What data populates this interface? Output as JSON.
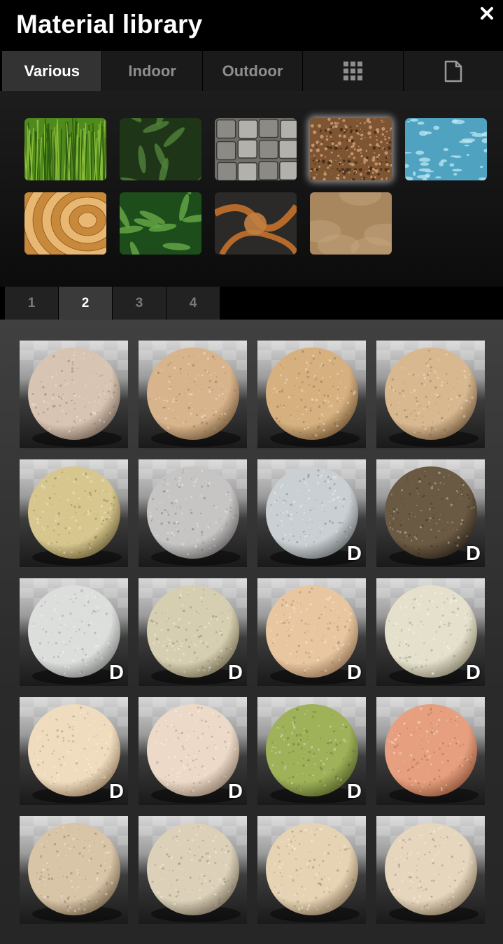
{
  "window": {
    "title": "Material library"
  },
  "tabs": [
    {
      "label": "Various",
      "active": true
    },
    {
      "label": "Indoor",
      "active": false
    },
    {
      "label": "Outdoor",
      "active": false
    },
    {
      "icon": "grid-icon",
      "active": false
    },
    {
      "icon": "document-icon",
      "active": false
    }
  ],
  "categories": [
    {
      "name": "grass",
      "colors": [
        "#4f8a1c",
        "#8cbd3a"
      ],
      "pattern": "grass"
    },
    {
      "name": "leaves",
      "colors": [
        "#1e3517",
        "#4e7e38"
      ],
      "pattern": "leaves"
    },
    {
      "name": "stone-wall",
      "colors": [
        "#6f6e6a",
        "#b3b1ab"
      ],
      "pattern": "stones"
    },
    {
      "name": "soil",
      "colors": [
        "#7d5533",
        "#c39469"
      ],
      "pattern": "speckle",
      "selected": true
    },
    {
      "name": "water",
      "colors": [
        "#4fa3c0",
        "#c3ebf5"
      ],
      "pattern": "water"
    },
    {
      "name": "wood",
      "colors": [
        "#c88a3a",
        "#e8b873"
      ],
      "pattern": "rings"
    },
    {
      "name": "foliage",
      "colors": [
        "#1e4d1c",
        "#63a444"
      ],
      "pattern": "leaves"
    },
    {
      "name": "abstract-metal",
      "colors": [
        "#2b2a28",
        "#b56a2c"
      ],
      "pattern": "abstract"
    },
    {
      "name": "sand",
      "colors": [
        "#a8875f",
        "#c9a982"
      ],
      "pattern": "smooth"
    }
  ],
  "pages": [
    {
      "label": "1",
      "active": false
    },
    {
      "label": "2",
      "active": true
    },
    {
      "label": "3",
      "active": false
    },
    {
      "label": "4",
      "active": false
    }
  ],
  "materials": [
    {
      "colors": [
        "#d8c4b2",
        "#6e5e51"
      ],
      "badge": ""
    },
    {
      "colors": [
        "#d8b48c",
        "#6e5436"
      ],
      "badge": ""
    },
    {
      "colors": [
        "#d6b07f",
        "#6d512f"
      ],
      "badge": ""
    },
    {
      "colors": [
        "#d8b88f",
        "#6e5539"
      ],
      "badge": ""
    },
    {
      "colors": [
        "#d7c78f",
        "#6b5d33"
      ],
      "badge": ""
    },
    {
      "colors": [
        "#c7c4c4",
        "#5f5c5c"
      ],
      "badge": ""
    },
    {
      "colors": [
        "#c9cfd2",
        "#616668"
      ],
      "badge": "D"
    },
    {
      "colors": [
        "#6b5a43",
        "#2a2218"
      ],
      "badge": "D"
    },
    {
      "colors": [
        "#dcdedb",
        "#777a77"
      ],
      "badge": "D"
    },
    {
      "colors": [
        "#d6ceb0",
        "#6f684d"
      ],
      "badge": "D"
    },
    {
      "colors": [
        "#e8c6a0",
        "#8c6c4e"
      ],
      "badge": "D"
    },
    {
      "colors": [
        "#e4e0cb",
        "#7f7b65"
      ],
      "badge": "D"
    },
    {
      "colors": [
        "#efdcbf",
        "#8d7659"
      ],
      "badge": "D"
    },
    {
      "colors": [
        "#ecd9c8",
        "#8a7665"
      ],
      "badge": "D"
    },
    {
      "colors": [
        "#9fb159",
        "#4e5b24"
      ],
      "badge": "D"
    },
    {
      "colors": [
        "#e6a07f",
        "#8a4f35"
      ],
      "badge": ""
    },
    {
      "colors": [
        "#d8c4a6",
        "#6f5e46"
      ],
      "badge": ""
    },
    {
      "colors": [
        "#dcd0b8",
        "#6f6654"
      ],
      "badge": ""
    },
    {
      "colors": [
        "#e6d3b4",
        "#7d6a4f"
      ],
      "badge": ""
    },
    {
      "colors": [
        "#e6d6bd",
        "#7d6d55"
      ],
      "badge": ""
    }
  ]
}
